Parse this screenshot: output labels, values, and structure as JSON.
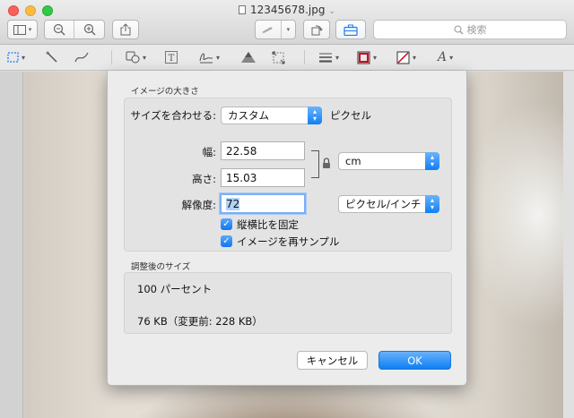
{
  "window": {
    "title": "12345678.jpg",
    "search_placeholder": "検索"
  },
  "dialog": {
    "image_size_section": "イメージの大きさ",
    "fit_to_label": "サイズを合わせる:",
    "fit_to_value": "カスタム",
    "fit_to_unit": "ピクセル",
    "width_label": "幅:",
    "width_value": "22.58",
    "height_label": "高さ:",
    "height_value": "15.03",
    "unit_value": "cm",
    "resolution_label": "解像度:",
    "resolution_value": "72",
    "resolution_unit": "ピクセル/インチ",
    "checkbox_proportional": "縦横比を固定",
    "checkbox_resample": "イメージを再サンプル",
    "result_section": "調整後のサイズ",
    "result_percent": "100 パーセント",
    "result_size": "76 KB（変更前: 228 KB）",
    "cancel_label": "キャンセル",
    "ok_label": "OK"
  },
  "colors": {
    "accent": "#0f7ff6",
    "close": "#fc605c",
    "minimize": "#fdbc40",
    "zoom": "#34c84a"
  },
  "icons": {
    "sidebar": "sidebar-icon",
    "zoom_out": "zoom-out-icon",
    "zoom_in": "zoom-in-icon",
    "share": "share-icon",
    "markup_pen": "pen-icon",
    "rotate": "rotate-icon",
    "toolbox": "toolbox-icon"
  }
}
